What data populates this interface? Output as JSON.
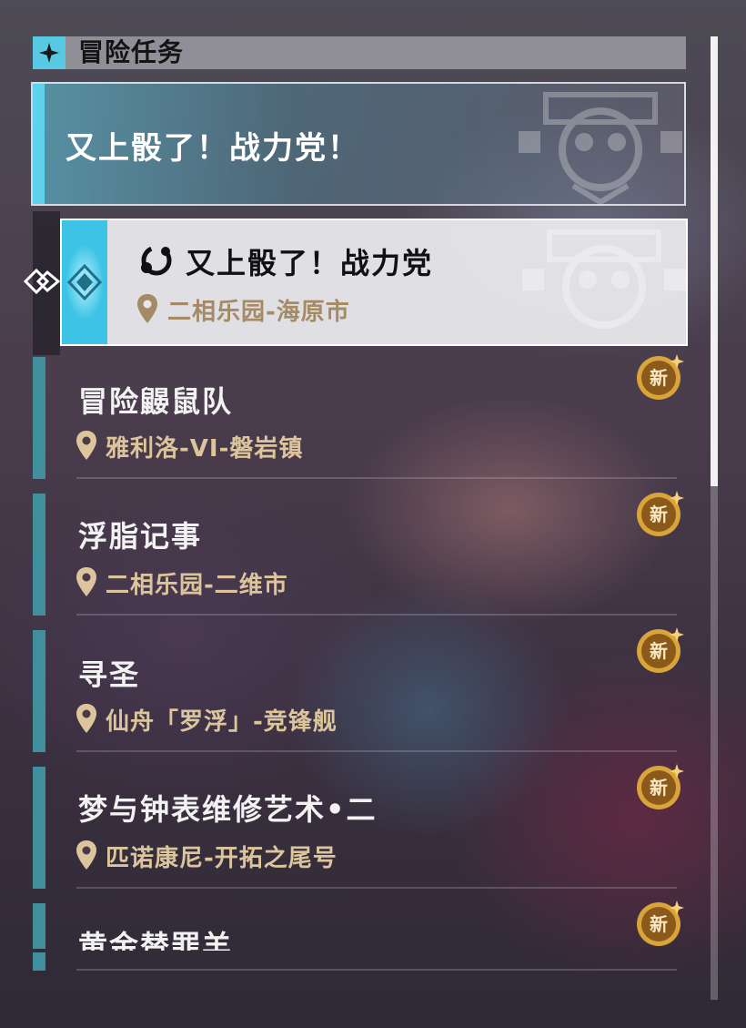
{
  "header": {
    "title": "冒险任务",
    "icon": "diamond-star-icon"
  },
  "group": {
    "title": "又上骰了！战力党！"
  },
  "selected": {
    "title": "又上骰了！战力党",
    "location": "二相乐园-海原市",
    "quest_icon": "quest-type-icon",
    "pin_icon": "location-pin-icon"
  },
  "items": [
    {
      "title": "冒险鼹鼠队",
      "location": "雅利洛-VI-磐岩镇",
      "badge": "新"
    },
    {
      "title": "浮脂记事",
      "location": "二相乐园-二维市",
      "badge": "新"
    },
    {
      "title": "寻圣",
      "location": "仙舟「罗浮」-竞锋舰",
      "badge": "新"
    },
    {
      "title": "梦与钟表维修艺术•二",
      "location": "匹诺康尼-开拓之尾号",
      "badge": "新"
    },
    {
      "title": "黄金替罪羊",
      "location": "",
      "badge": "新"
    }
  ],
  "colors": {
    "accent": "#58c9e3",
    "location_text": "#dcc59c",
    "badge": "#d9a53b"
  }
}
